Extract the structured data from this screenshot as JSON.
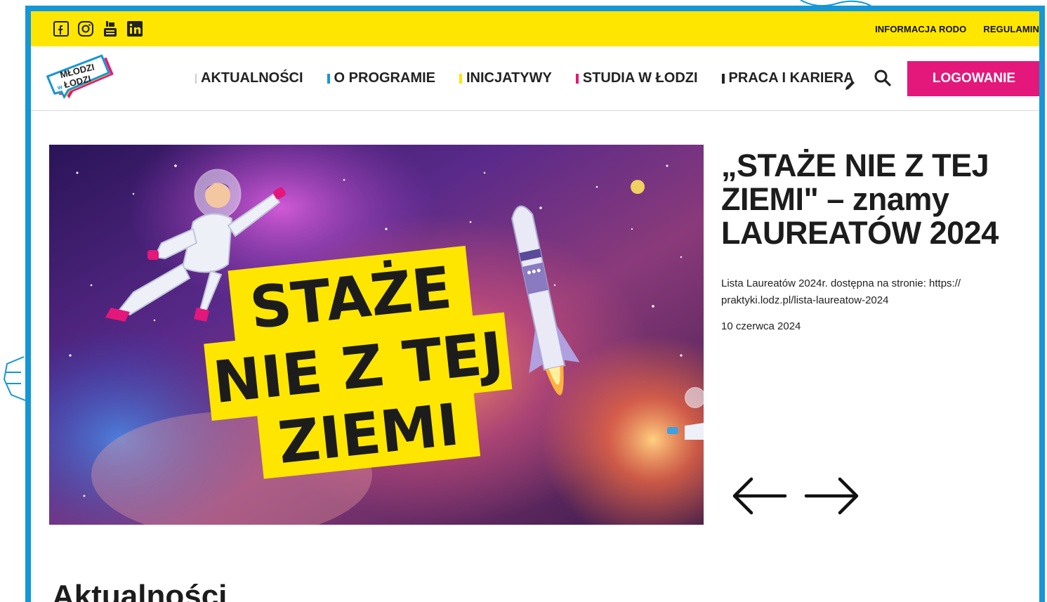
{
  "social": [
    {
      "icon": "facebook-icon"
    },
    {
      "icon": "instagram-icon"
    },
    {
      "icon": "youtube-icon"
    },
    {
      "icon": "linkedin-icon"
    }
  ],
  "toplinks": {
    "rodo": "INFORMACJA RODO",
    "regulamin": "REGULAMIN"
  },
  "logo": {
    "line1": "MŁODZI",
    "line2": "w",
    "line3": "ŁODZI"
  },
  "nav": {
    "items": [
      {
        "label": "AKTUALNOŚCI",
        "accent": "#cccccc"
      },
      {
        "label": "O PROGRAMIE",
        "accent": "#1596d6"
      },
      {
        "label": "INICJATYWY",
        "accent": "#ffe600"
      },
      {
        "label": "STUDIA W ŁODZI",
        "accent": "#e4177a"
      },
      {
        "label": "PRACA I KARIERA",
        "accent": "#222222"
      }
    ],
    "login_label": "LOGOWANIE"
  },
  "hero": {
    "image_text": [
      "STAŻE",
      "NIE Z TEJ",
      "ZIEMI"
    ],
    "title": "„STAŻE NIE Z TEJ ZIEMI\" – znamy LAUREATÓW 2024",
    "description": "Lista Laureatów 2024r. dostępna na stronie: https:// praktyki.lodz.pl/lista-laureatow-2024",
    "date": "10 czerwca 2024"
  },
  "section": {
    "title": "Aktualności"
  },
  "colors": {
    "frame": "#1596d6",
    "topbar": "#ffe600",
    "login": "#e4177a"
  }
}
